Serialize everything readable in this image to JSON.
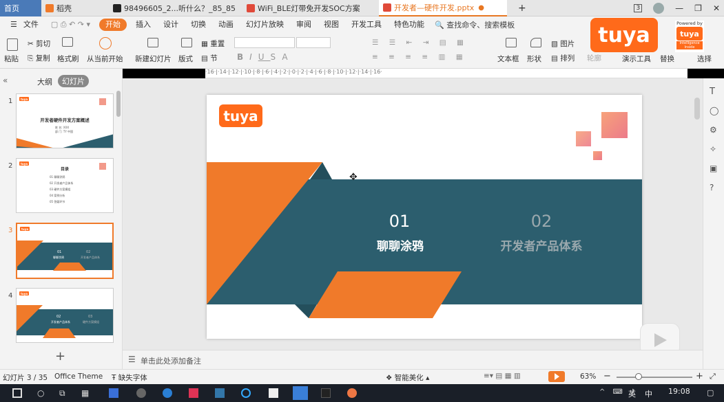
{
  "tabs": [
    {
      "label": "首页"
    },
    {
      "label": "稻壳"
    },
    {
      "label": "98496605_2...听什么？_85_85"
    },
    {
      "label": "WiFi_BLE灯带免开发SOC方案"
    },
    {
      "label": "开发者—硬件开发.pptx"
    }
  ],
  "tab_add": "+",
  "window": {
    "counter": "3",
    "minimize": "—",
    "restore": "❐",
    "close": "✕"
  },
  "menu": {
    "file": "文件",
    "items": [
      "开始",
      "插入",
      "设计",
      "切换",
      "动画",
      "幻灯片放映",
      "审阅",
      "视图",
      "开发工具",
      "特色功能"
    ],
    "search": "查找命令、搜索模板"
  },
  "ribbon": {
    "paste": "粘贴",
    "cut": "剪切",
    "copy": "复制",
    "format_painter": "格式刷",
    "from_current": "从当前开始",
    "new_slide": "新建幻灯片",
    "layout": "版式",
    "reset": "重置",
    "section": "节",
    "text_box": "文本框",
    "shape": "形状",
    "arrange": "排列",
    "picture": "图片",
    "fill": "轮廓",
    "present_tool": "演示工具",
    "replace": "替换",
    "select": "选择",
    "bold": "B",
    "italic": "I",
    "underline": "U",
    "strike": "S",
    "font_a": "A"
  },
  "panel": {
    "outline": "大纲",
    "slides": "幻灯片",
    "collapse": "«",
    "add": "+"
  },
  "thumbs": [
    {
      "num": "1",
      "title": "开发者硬件开发方案概述",
      "sub1": "姓 名: XXX",
      "sub2": "部 门: TY 中国"
    },
    {
      "num": "2",
      "title": "目录",
      "items": [
        "01   聊聊涂鸦",
        "02   开发者产品体系",
        "03   硬件方案模组",
        "04   案例分析",
        "05   答疑环节"
      ]
    },
    {
      "num": "3",
      "a": "01",
      "b": "02",
      "la": "聊聊涂鸦",
      "lb": "开发者产品体系"
    },
    {
      "num": "4",
      "a": "02",
      "b": "03",
      "la": "开发者产品体系",
      "lb": "硬件方案模组"
    }
  ],
  "slide": {
    "logo": "tuya",
    "num1": "01",
    "label1": "聊聊涂鸦",
    "num2": "02",
    "label2": "开发者产品体系"
  },
  "ruler": "·16·|·14·|·12·|·10·|·8·|·6·|·4·|·2·|·0·|·2·|·4·|·6·|·8·|·10·|·12·|·14·|·16·",
  "notes": "单击此处添加备注",
  "status": {
    "slide_count": "幻灯片 3 / 35",
    "theme": "Office Theme",
    "missing_font": "缺失字体",
    "beautify": "智能美化",
    "zoom": "63%",
    "minus": "−",
    "plus": "+"
  },
  "overlay": {
    "brand": "tuya",
    "powered": "Powered by",
    "badge": "tuya",
    "badge_sub": "Intelligence Inside"
  },
  "taskbar": {
    "time": "19:08",
    "ime": "英",
    "ime2": "中"
  },
  "colors": {
    "orange": "#f07a2a",
    "teal": "#2c5e6e",
    "accent": "#ff6a1a"
  }
}
